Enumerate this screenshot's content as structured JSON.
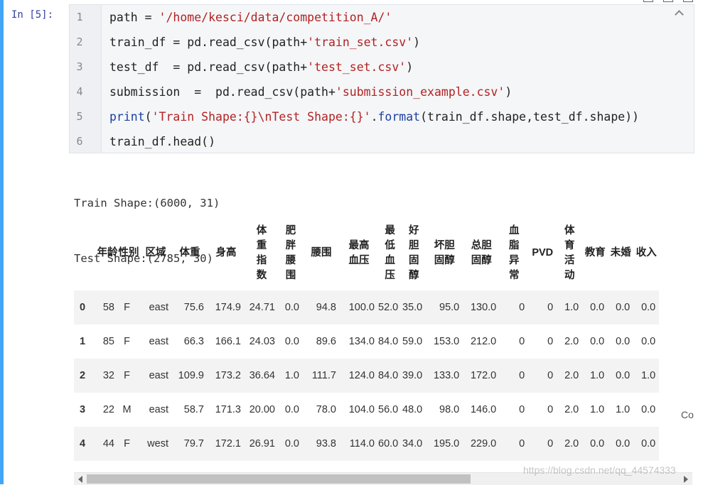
{
  "cell": {
    "prompt": "In [5]:",
    "code_lines": [
      {
        "n": "1",
        "parts": [
          {
            "t": "path = ",
            "c": ""
          },
          {
            "t": "'/home/kesci/data/competition_A/'",
            "c": "s"
          }
        ]
      },
      {
        "n": "2",
        "parts": [
          {
            "t": "train_df = pd.read_csv(path+",
            "c": ""
          },
          {
            "t": "'train_set.csv'",
            "c": "s"
          },
          {
            "t": ")",
            "c": ""
          }
        ]
      },
      {
        "n": "3",
        "parts": [
          {
            "t": "test_df  = pd.read_csv(path+",
            "c": ""
          },
          {
            "t": "'test_set.csv'",
            "c": "s"
          },
          {
            "t": ")",
            "c": ""
          }
        ]
      },
      {
        "n": "4",
        "parts": [
          {
            "t": "submission  =  pd.read_csv(path+",
            "c": ""
          },
          {
            "t": "'submission_example.csv'",
            "c": "s"
          },
          {
            "t": ")",
            "c": ""
          }
        ]
      },
      {
        "n": "5",
        "parts": [
          {
            "t": "print",
            "c": "k"
          },
          {
            "t": "(",
            "c": ""
          },
          {
            "t": "'Train Shape:{}\\nTest Shape:{}'",
            "c": "s"
          },
          {
            "t": ".",
            "c": ""
          },
          {
            "t": "format",
            "c": "k"
          },
          {
            "t": "(train_df.shape,test_df.shape))",
            "c": ""
          }
        ]
      },
      {
        "n": "6",
        "parts": [
          {
            "t": "train_df.head()",
            "c": ""
          }
        ]
      }
    ],
    "stdout": [
      "Train Shape:(6000, 31)",
      "Test Shape:(2785, 30)"
    ]
  },
  "dataframe": {
    "columns": [
      "年龄",
      "性别",
      "区域",
      "体重",
      "身高",
      "体重指数",
      "肥胖腰围",
      "腰围",
      "最高血压",
      "最低血压",
      "好胆固醇",
      "坏胆固醇",
      "总胆固醇",
      "血脂异常",
      "PVD",
      "体育活动",
      "教育",
      "未婚",
      "收入"
    ],
    "rows": [
      {
        "index": "0",
        "cells": [
          "58",
          "F",
          "east",
          "75.6",
          "174.9",
          "24.71",
          "0.0",
          "94.8",
          "100.0",
          "52.0",
          "35.0",
          "95.0",
          "130.0",
          "0",
          "0",
          "1.0",
          "0.0",
          "0.0",
          "0.0"
        ]
      },
      {
        "index": "1",
        "cells": [
          "85",
          "F",
          "east",
          "66.3",
          "166.1",
          "24.03",
          "0.0",
          "89.6",
          "134.0",
          "84.0",
          "59.0",
          "153.0",
          "212.0",
          "0",
          "0",
          "2.0",
          "0.0",
          "0.0",
          "0.0"
        ]
      },
      {
        "index": "2",
        "cells": [
          "32",
          "F",
          "east",
          "109.9",
          "173.2",
          "36.64",
          "1.0",
          "111.7",
          "124.0",
          "84.0",
          "39.0",
          "133.0",
          "172.0",
          "0",
          "0",
          "2.0",
          "1.0",
          "0.0",
          "1.0"
        ]
      },
      {
        "index": "3",
        "cells": [
          "22",
          "M",
          "east",
          "58.7",
          "171.3",
          "20.00",
          "0.0",
          "78.0",
          "104.0",
          "56.0",
          "48.0",
          "98.0",
          "146.0",
          "0",
          "0",
          "2.0",
          "1.0",
          "1.0",
          "0.0"
        ]
      },
      {
        "index": "4",
        "cells": [
          "44",
          "F",
          "west",
          "79.7",
          "172.1",
          "26.91",
          "0.0",
          "93.8",
          "114.0",
          "60.0",
          "34.0",
          "195.0",
          "229.0",
          "0",
          "0",
          "2.0",
          "0.0",
          "0.0",
          "0.0"
        ]
      }
    ],
    "cut_off_text": "Co"
  },
  "watermark": "https://blog.csdn.net/qq_44574333",
  "colors": {
    "cell_bar": "#42a5f5",
    "string": "#b22222",
    "keyword": "#1a3fa0"
  }
}
